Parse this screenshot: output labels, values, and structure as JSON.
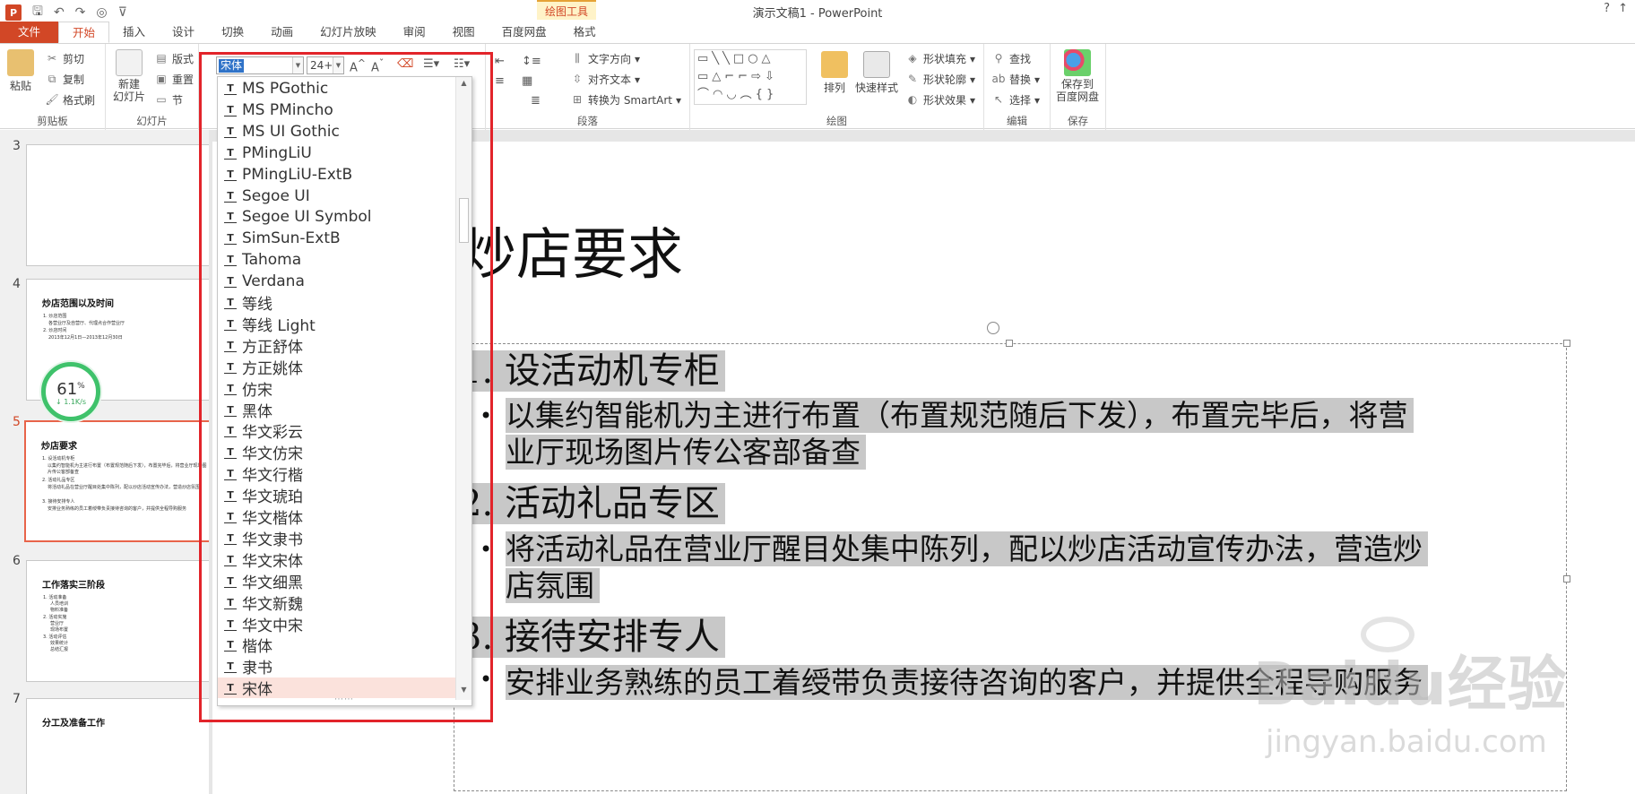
{
  "window": {
    "title": "演示文稿1 - PowerPoint",
    "contextual_tab": "绘图工具",
    "help": "?"
  },
  "tabs": {
    "file": "文件",
    "items": [
      "开始",
      "插入",
      "设计",
      "切换",
      "动画",
      "幻灯片放映",
      "审阅",
      "视图",
      "百度网盘",
      "格式"
    ]
  },
  "ribbon": {
    "clipboard": {
      "paste": "粘贴",
      "cut": "剪切",
      "copy": "复制",
      "format_painter": "格式刷",
      "label": "剪贴板"
    },
    "slides": {
      "new_slide": "新建\n幻灯片",
      "layout": "版式",
      "reset": "重置",
      "section": "节",
      "label": "幻灯片"
    },
    "font": {
      "name": "宋体",
      "size": "24+"
    },
    "paragraph": {
      "text_direction": "文字方向",
      "align_text": "对齐文本",
      "smartart": "转换为 SmartArt",
      "label": "段落"
    },
    "drawing": {
      "arrange": "排列",
      "quick_styles": "快速样式",
      "shape_fill": "形状填充",
      "shape_outline": "形状轮廓",
      "shape_effects": "形状效果",
      "label": "绘图"
    },
    "editing": {
      "find": "查找",
      "replace": "替换",
      "select": "选择",
      "label": "编辑"
    },
    "save": {
      "save_to": "保存到\n百度网盘",
      "label": "保存"
    }
  },
  "font_dropdown": {
    "fonts": [
      "MS PGothic",
      "MS PMincho",
      "MS UI Gothic",
      "PMingLiU",
      "PMingLiU-ExtB",
      "Segoe UI",
      "Segoe UI Symbol",
      "SimSun-ExtB",
      "Tahoma",
      "Verdana",
      "等线",
      "等线 Light",
      "方正舒体",
      "方正姚体",
      "仿宋",
      "黑体",
      "华文彩云",
      "华文仿宋",
      "华文行楷",
      "华文琥珀",
      "华文楷体",
      "华文隶书",
      "华文宋体",
      "华文细黑",
      "华文新魏",
      "华文中宋",
      "楷体",
      "隶书",
      "宋体"
    ],
    "selected": "宋体",
    "grip": "⋯⋯"
  },
  "thumbnails": [
    {
      "num": "3",
      "title": ""
    },
    {
      "num": "4",
      "title": "炒店范围以及时间",
      "lines": [
        "1. 炒店范围",
        "各营业厅及自营厅、代理点合作营业厅",
        "2. 炒店时间",
        "2013年12月1日—2013年12月30日"
      ]
    },
    {
      "num": "5",
      "title": "炒店要求",
      "lines": [
        "1. 设活动机专柜",
        "以集约智能机为主进行布置（布置规范随后下发），布置完毕后，将营业厅现场图片传公客部备查",
        "2. 活动礼品专区",
        "将活动礼品在营业厅醒目处集中陈列，配以炒店活动宣传办法，营造炒店氛围",
        "3. 接待安排专人",
        "安排业务熟练的员工着绶带负责接待咨询的客户，并提供全程导购服务"
      ]
    },
    {
      "num": "6",
      "title": "工作落实三阶段",
      "lines": [
        "1. 活动准备",
        "人员培训",
        "物料准备",
        "2. 活动实施",
        "营业厅",
        "现场布置",
        "3. 活动评估",
        "效果统计",
        "总结汇报"
      ]
    },
    {
      "num": "7",
      "title": "分工及准备工作"
    }
  ],
  "speed_widget": {
    "percent": "61",
    "unit": "%",
    "rate": "1.1K/s"
  },
  "slide": {
    "title": "炒店要求",
    "items": [
      {
        "level": 1,
        "text": "1. 设活动机专柜"
      },
      {
        "level": 2,
        "text": "以集约智能机为主进行布置（布置规范随后下发），布置完毕后，将营"
      },
      {
        "level": 2,
        "text": "业厅现场图片传公客部备查"
      },
      {
        "level": 1,
        "text": "2. 活动礼品专区"
      },
      {
        "level": 2,
        "text": "将活动礼品在营业厅醒目处集中陈列，配以炒店活动宣传办法，营造炒"
      },
      {
        "level": 2,
        "text": "店氛围"
      },
      {
        "level": 1,
        "text": "3. 接待安排专人"
      },
      {
        "level": 2,
        "text": "安排业务熟练的员工着绶带负责接待咨询的客户，并提供全程导购服务"
      }
    ]
  },
  "watermark": {
    "logo": "Baidu经验",
    "url": "jingyan.baidu.com"
  },
  "colors": {
    "accent": "#d24726",
    "highlight": "#c8c8c8",
    "annotation": "#e2242a",
    "progress": "#3fc26b"
  }
}
